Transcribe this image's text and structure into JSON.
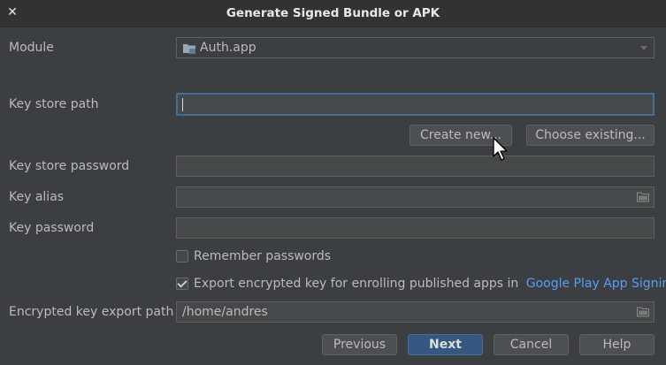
{
  "window": {
    "title": "Generate Signed Bundle or APK",
    "close_glyph": "✕"
  },
  "module": {
    "label": "Module",
    "value": "Auth.app",
    "icon": "module-folder-icon"
  },
  "key_store_path": {
    "label": "Key store path",
    "value": ""
  },
  "key_store_buttons": {
    "create_new": "Create new...",
    "choose_existing": "Choose existing..."
  },
  "key_store_password": {
    "label": "Key store password",
    "value": ""
  },
  "key_alias": {
    "label": "Key alias",
    "value": "",
    "icon": "folder-browse-icon"
  },
  "key_password": {
    "label": "Key password",
    "value": ""
  },
  "remember_passwords": {
    "label": "Remember passwords",
    "checked": false
  },
  "export_encrypted": {
    "label": "Export encrypted key for enrolling published apps in",
    "link": "Google Play App Signing",
    "checked": true
  },
  "encrypted_key_export_path": {
    "label": "Encrypted key export path",
    "value": "/home/andres",
    "icon": "folder-browse-icon"
  },
  "footer": {
    "previous": "Previous",
    "next": "Next",
    "cancel": "Cancel",
    "help": "Help"
  },
  "colors": {
    "background": "#3c3f41",
    "primary_button": "#365880",
    "link": "#589df6",
    "focus_border": "#466d94"
  }
}
